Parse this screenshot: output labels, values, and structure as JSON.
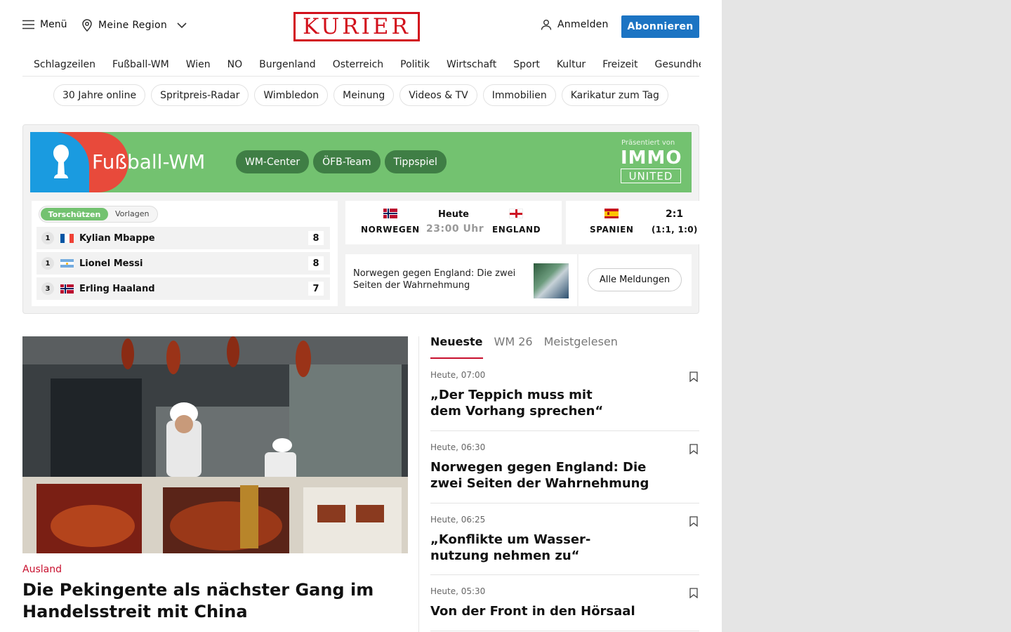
{
  "header": {
    "menu_label": "Menü",
    "region_label": "Meine Region",
    "logo_text": "KURIER",
    "login_label": "Anmelden",
    "subscribe_label": "Abonnieren",
    "brand_color": "#d2111c",
    "accent_color": "#1c74c3"
  },
  "nav": [
    "Schlagzeilen",
    "Fußball-WM",
    "Wien",
    "NÖ",
    "Burgenland",
    "Österreich",
    "Politik",
    "Wirtschaft",
    "Sport",
    "Kultur",
    "Freizeit",
    "Gesundheit"
  ],
  "pills": [
    "30 Jahre online",
    "Spritpreis-Radar",
    "Wimbledon",
    "Meinung",
    "Videos & TV",
    "Immobilien",
    "Karikatur zum Tag"
  ],
  "wm": {
    "title": "Fußball-WM",
    "tabs": [
      "WM-Center",
      "ÖFB-Team",
      "Tippspiel"
    ],
    "sponsor_label": "Präsentiert von",
    "sponsor_name_1": "IMMO",
    "sponsor_name_2": "UNITED",
    "toggle_active": "Torschützen",
    "toggle_inactive": "Vorlagen",
    "scorers": [
      {
        "rank": "1",
        "name": "Kylian Mbappe",
        "goals": "8",
        "flag": "france-flag"
      },
      {
        "rank": "1",
        "name": "Lionel Messi",
        "goals": "8",
        "flag": "argentina-flag"
      },
      {
        "rank": "3",
        "name": "Erling Haaland",
        "goals": "7",
        "flag": "norway-flag"
      }
    ],
    "match1": {
      "home": "NORWEGEN",
      "away": "ENGLAND",
      "day": "Heute",
      "time": "23:00 Uhr"
    },
    "match2": {
      "home": "SPANIEN",
      "score": "2:1",
      "halftime": "(1:1, 1:0)"
    },
    "news_text": "Norwegen gegen England: Die zwei Seiten der Wahrnehmung",
    "all_news_label": "Alle Meldungen"
  },
  "main_story": {
    "category": "Ausland",
    "headline": "Die Pekingente als nächster Gang im Handelsstreit mit China"
  },
  "sidebar": {
    "tabs": [
      "Neueste",
      "WM 26",
      "Meistgelesen"
    ],
    "items": [
      {
        "time": "Heute, 07:00",
        "title": "„Der Teppich muss mit dem Vorhang sprechen“"
      },
      {
        "time": "Heute, 06:30",
        "title": "Norwegen gegen England: Die zwei Seiten der Wahrnehmung"
      },
      {
        "time": "Heute, 06:25",
        "title": "„Konflikte um Wasser-nutzung nehmen zu“"
      },
      {
        "time": "Heute, 05:30",
        "title": "Von der Front in den Hörsaal"
      }
    ]
  }
}
